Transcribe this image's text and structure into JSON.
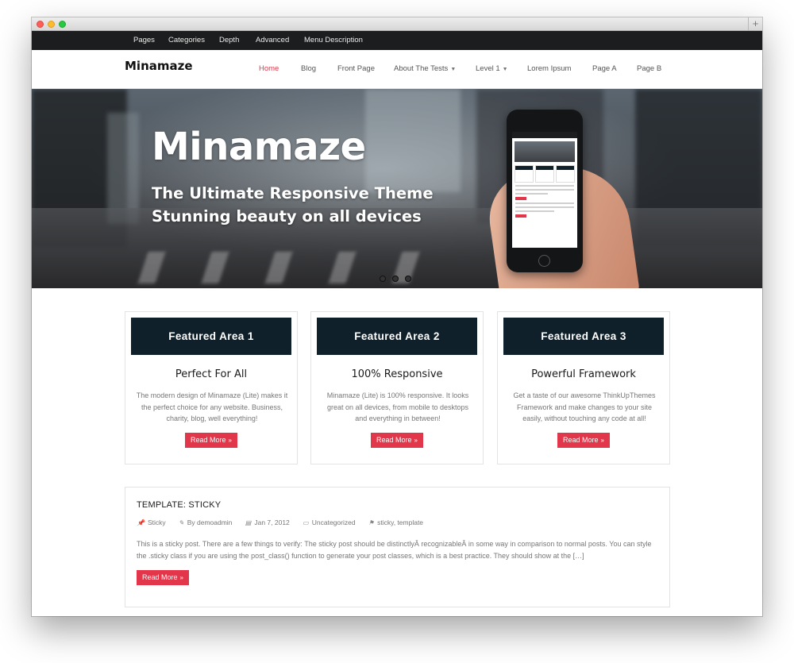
{
  "topbar": {
    "items": [
      "Pages",
      "Categories",
      "Depth",
      "Advanced",
      "Menu Description"
    ]
  },
  "header": {
    "logo": "Minamaze",
    "nav": [
      {
        "label": "Home",
        "active": true
      },
      {
        "label": "Blog"
      },
      {
        "label": "Front Page"
      },
      {
        "label": "About The Tests",
        "dropdown": true
      },
      {
        "label": "Level 1",
        "dropdown": true
      },
      {
        "label": "Lorem Ipsum"
      },
      {
        "label": "Page A"
      },
      {
        "label": "Page B"
      }
    ]
  },
  "hero": {
    "title": "Minamaze",
    "subtitle_line1": "The Ultimate Responsive Theme",
    "subtitle_line2": "Stunning beauty on all devices",
    "slides": 3
  },
  "featured": [
    {
      "head": "Featured Area 1",
      "title": "Perfect For All",
      "text": "The modern design of Minamaze (Lite) makes it the perfect choice for any website. Business, charity, blog, well everything!",
      "button": "Read More"
    },
    {
      "head": "Featured Area 2",
      "title": "100% Responsive",
      "text": "Minamaze (Lite) is 100% responsive. It looks great on all devices, from mobile to desktops and everything in between!",
      "button": "Read More"
    },
    {
      "head": "Featured Area 3",
      "title": "Powerful Framework",
      "text": "Get a taste of our awesome ThinkUpThemes Framework and make changes to your site easily, without touching any code at all!",
      "button": "Read More"
    }
  ],
  "post": {
    "title": "TEMPLATE: STICKY",
    "meta": {
      "sticky": "Sticky",
      "author": "By demoadmin",
      "date": "Jan 7, 2012",
      "category": "Uncategorized",
      "tags": "sticky, template"
    },
    "body": "This is a sticky post. There are a few things to verify: The sticky post should be distinctlyÂ recognizableÂ in some way in comparison to normal posts. You can style the .sticky class if you are using the post_class() function to generate your post classes, which is a best practice. They should show at the […]",
    "button": "Read More"
  },
  "colors": {
    "accent": "#e2374a",
    "card_head": "#10202a",
    "topbar": "#1b1d1f"
  },
  "icons": {
    "read_more": "chevron-double-right-icon",
    "sticky": "pin-icon",
    "author": "pencil-icon",
    "date": "calendar-icon",
    "category": "folder-icon",
    "tags": "tag-icon"
  }
}
